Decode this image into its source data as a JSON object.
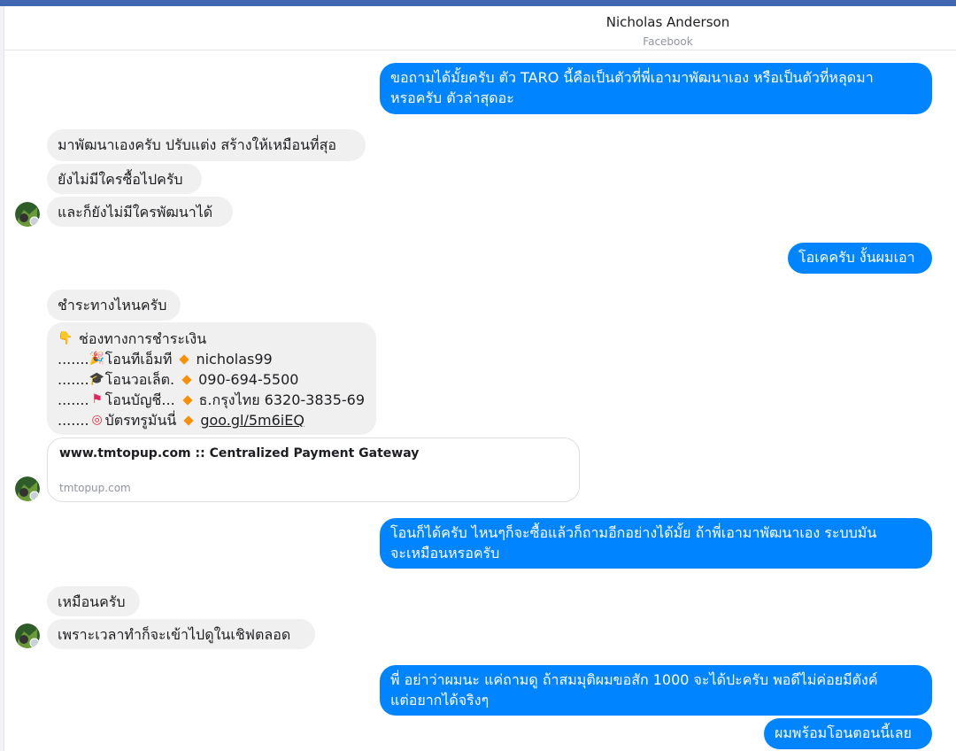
{
  "header": {
    "contact_name": "Nicholas Anderson",
    "source": "Facebook"
  },
  "colors": {
    "outgoing_bubble": "#0084ff",
    "incoming_bubble": "#f1f0f0",
    "top_bar": "#4267b2"
  },
  "messages": {
    "m1_line1": "ขอถามได้มั้ยครับ ตัว TARO นี้คือเป็นตัวที่พี่เอามาพัฒนาเอง หรือเป็นตัวที่หลุดมา",
    "m1_line2": "หรอครับ ตัวล่าสุดอะ",
    "m2": "มาพัฒนาเองครับ ปรับแต่ง สร้างให้เหมือนที่สุอ",
    "m3": "ยังไม่มีใครซื้อไปครับ",
    "m4": "และก็ยังไม่มีใครพัฒนาได้",
    "m5": "โอเคครับ งั้นผมเอา",
    "m6": "ชำระทางไหนครับ",
    "m8_line1": "โอนก็ได้ครับ ไหนๆก็จะซื้อแล้วก็ถามอีกอย่างได้มั้ย ถ้าพี่เอามาพัฒนาเอง ระบบมัน",
    "m8_line2": "จะเหมือนหรอครับ",
    "m9": "เหมือนครับ",
    "m10": "เพราะเวลาทำก็จะเข้าไปดูในเชิฟตลอด",
    "m11_line1": "พี่ อย่าว่าผมนะ แค่ถามดู ถ้าสมมุติผมขอสัก 1000 จะได้ปะครับ พอดีไม่ค่อยมีตังค์",
    "m11_line2": "แต่อยากได้จริงๆ",
    "m12": "ผมพร้อมโอนตอนนี้เลย"
  },
  "payment": {
    "title": "ช่องทางการชำระเงิน",
    "title_icon": "pointing-hand-icon",
    "rows": [
      {
        "dots": ".......",
        "icon": "party-popper-icon",
        "label": "โอนทีเอ็มที",
        "value": "nicholas99"
      },
      {
        "dots": ".......",
        "icon": "graduation-cap-icon",
        "label": "โอนวอเล็ต.",
        "value": "090-694-5500"
      },
      {
        "dots": ".......",
        "icon": "red-flag-icon",
        "label": "โอนบัญชี...",
        "value": "ธ.กรุงไทย 6320-3835-69"
      },
      {
        "dots": ".......",
        "icon": "target-icon",
        "label": "บัตรทรูมันนี่",
        "value": "goo.gl/5m6iEQ"
      }
    ]
  },
  "link_preview": {
    "title": "www.tmtopup.com :: Centralized Payment Gateway",
    "domain": "tmtopup.com"
  }
}
